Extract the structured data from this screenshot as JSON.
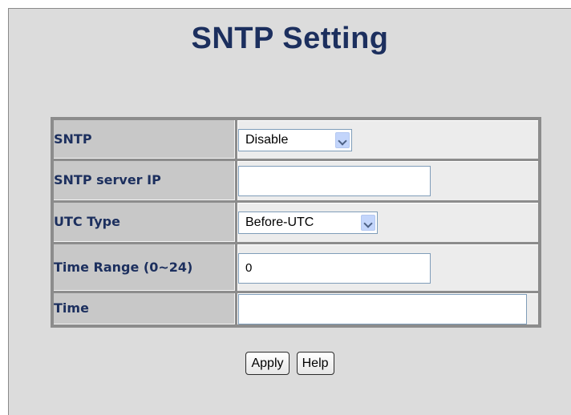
{
  "page": {
    "title": "SNTP Setting"
  },
  "form": {
    "rows": [
      {
        "label": "SNTP",
        "selected": "Disable"
      },
      {
        "label": "SNTP server IP",
        "value": ""
      },
      {
        "label": "UTC Type",
        "selected": "Before-UTC"
      },
      {
        "label": "Time Range (0~24)",
        "value": "0"
      },
      {
        "label": "Time",
        "value": ""
      }
    ]
  },
  "buttons": {
    "apply": "Apply",
    "help": "Help"
  }
}
